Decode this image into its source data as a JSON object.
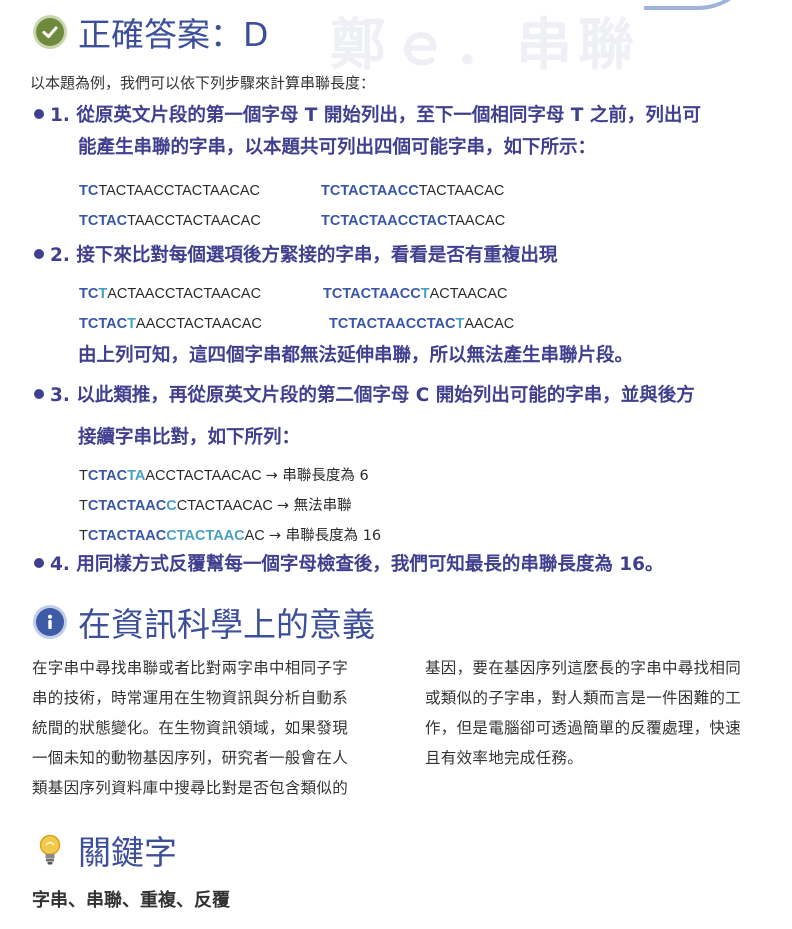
{
  "section_answer": {
    "title": "正確答案：D",
    "intro": "以本題為例，我們可以依下列步驟來計算串聯長度：",
    "step1_line1": "1. 從原英文片段的第一個字母 T 開始列出，至下一個相同字母 T 之前，列出可",
    "step1_line2": "能產生串聯的字串，以本題共可列出四個可能字串，如下所示：",
    "step1_seqs": [
      {
        "hl": "TC",
        "rest": "TACTAACCTACTAACAC"
      },
      {
        "hl": "TCTACTAACC",
        "rest": "TACTAACAC"
      },
      {
        "hl": "TCTAC",
        "rest": "TAACCTACTAACAC"
      },
      {
        "hl": "TCTACTAACCTAC",
        "rest": "TAACAC"
      }
    ],
    "step2_line1": "2. 接下來比對每個選項後方緊接的字串，看看是否有重複出現",
    "step2_seqs": [
      {
        "b": "TC",
        "c": "T",
        "rest": "ACTAACCTACTAACAC"
      },
      {
        "b": "TCTACTAACC",
        "c": "T",
        "rest": "ACTAACAC"
      },
      {
        "b": "TCTAC",
        "c": "T",
        "rest": "AACCTACTAACAC"
      },
      {
        "b": "TCTACTAACCTAC",
        "c": "T",
        "rest": "AACAC"
      }
    ],
    "step2_conclusion": "由上列可知，這四個字串都無法延伸串聯，所以無法產生串聯片段。",
    "step3_line1": "3. 以此類推，再從原英文片段的第二個字母 C 開始列出可能的字串，並與後方",
    "step3_line2": "接續字串比對，如下所列：",
    "step3_seqs": [
      {
        "pre": "T",
        "b": "CTAC",
        "c": "TA",
        "rest": "ACCTACTAACAC",
        "result": "→ 串聯長度為 6"
      },
      {
        "pre": "T",
        "b": "CTACTAAC",
        "c": "C",
        "rest": "CTACTAACAC",
        "result": "→ 無法串聯"
      },
      {
        "pre": "T",
        "b": "CTACTAAC",
        "c": "CTACTAAC",
        "rest": "AC",
        "result": "→ 串聯長度為 16"
      }
    ],
    "step4_line1": "4. 用同樣方式反覆幫每一個字母檢查後，我們可知最長的串聯長度為 16。"
  },
  "section_meaning": {
    "title": "在資訊科學上的意義",
    "left_lines": [
      "在字串中尋找串聯或者比對兩字串中相同子字",
      "串的技術，時常運用在生物資訊與分析自動系",
      "統間的狀態變化。在生物資訊領域，如果發現",
      "一個未知的動物基因序列，研究者一般會在人",
      "類基因序列資料庫中搜尋比對是否包含類似的"
    ],
    "right_lines": [
      "基因，要在基因序列這麼長的字串中尋找相同",
      "或類似的子字串，對人類而言是一件困難的工",
      "作，但是電腦卻可透過簡單的反覆處理，快速",
      "且有效率地完成任務。"
    ]
  },
  "section_keywords": {
    "title": "關鍵字",
    "list": "字串、串聯、重複、反覆"
  },
  "colors": {
    "heading": "#3d4f9a",
    "step_text": "#40408f",
    "seq_blue": "#3a56a8",
    "seq_cyan": "#4aa0c2"
  }
}
